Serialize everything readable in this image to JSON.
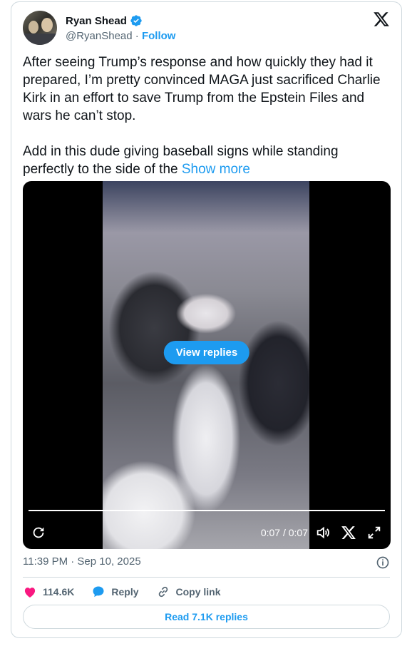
{
  "author": {
    "name": "Ryan Shead",
    "handle": "@RyanShead",
    "separator": "·",
    "follow_label": "Follow"
  },
  "tweet": {
    "text": "After seeing Trump’s response and how quickly they had it prepared, I’m pretty convinced MAGA just sacrificed Charlie Kirk in an effort to save Trump from the Epstein Files and wars he can’t stop.\n\nAdd in this dude giving baseball signs while standing perfectly to the side of the ",
    "show_more_label": "Show more"
  },
  "video": {
    "view_replies_label": "View replies",
    "timecode": "0:07 / 0:07",
    "progress": 1.0
  },
  "meta": {
    "timestamp": "11:39 PM · Sep 10, 2025"
  },
  "actions": {
    "like_count": "114.6K",
    "reply_label": "Reply",
    "copy_link_label": "Copy link"
  },
  "read_replies_label": "Read 7.1K replies",
  "colors": {
    "accent": "#1d9bf0",
    "like": "#f91880",
    "text": "#0f1419",
    "secondary": "#536471",
    "border": "#cfd9de"
  },
  "icons": [
    "verified-badge-icon",
    "x-logo-icon",
    "replay-icon",
    "volume-icon",
    "x-small-icon",
    "fullscreen-icon",
    "info-icon",
    "heart-icon",
    "reply-bubble-icon",
    "link-icon"
  ]
}
